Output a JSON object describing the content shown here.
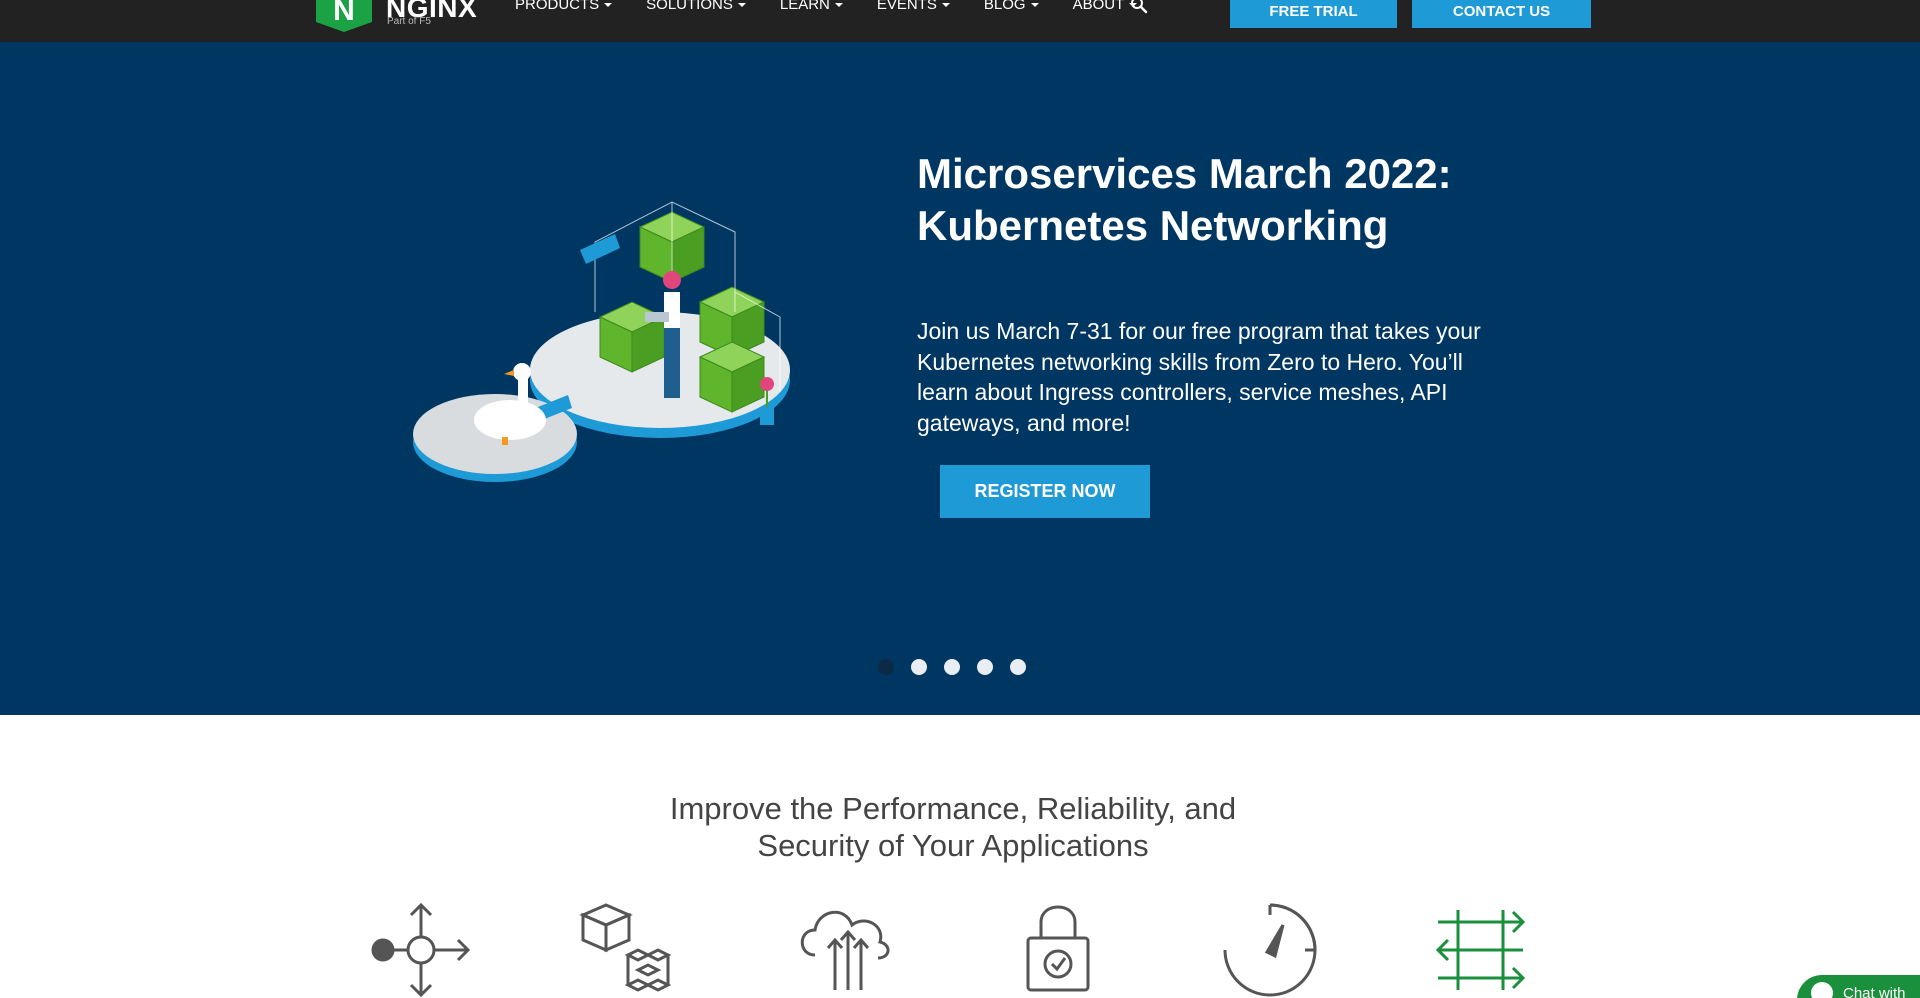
{
  "brand": {
    "name": "NGINX",
    "tagline": "Part of F5",
    "logo_letter": "N",
    "logo_color": "#1ba244"
  },
  "nav": {
    "items": [
      {
        "label": "PRODUCTS"
      },
      {
        "label": "SOLUTIONS"
      },
      {
        "label": "LEARN"
      },
      {
        "label": "EVENTS"
      },
      {
        "label": "BLOG"
      },
      {
        "label": "ABOUT"
      }
    ],
    "search_icon": "search-icon",
    "free_trial": "FREE TRIAL",
    "contact_us": "CONTACT US"
  },
  "hero": {
    "title_line1": "Microservices March 2022:",
    "title_line2": "Kubernetes Networking",
    "description": "Join us March 7-31 for our free program that takes your Kubernetes networking skills from Zero to Hero. You’ll learn about Ingress controllers, service meshes, API gateways, and more!",
    "cta": "REGISTER NOW",
    "bg_color": "#003762",
    "slides_total": 5,
    "active_slide": 1
  },
  "section": {
    "title_line1": "Improve the Performance, Reliability, and",
    "title_line2": "Security of Your Applications",
    "icons": [
      "load-balancer-icon",
      "microservices-icon",
      "cloud-upload-icon",
      "security-lock-icon",
      "performance-gauge-icon",
      "traffic-routing-icon"
    ]
  },
  "chat": {
    "label": "Chat with"
  },
  "colors": {
    "accent": "#1e9ad6",
    "nav_bg": "#222222",
    "green": "#1a8f3c"
  }
}
